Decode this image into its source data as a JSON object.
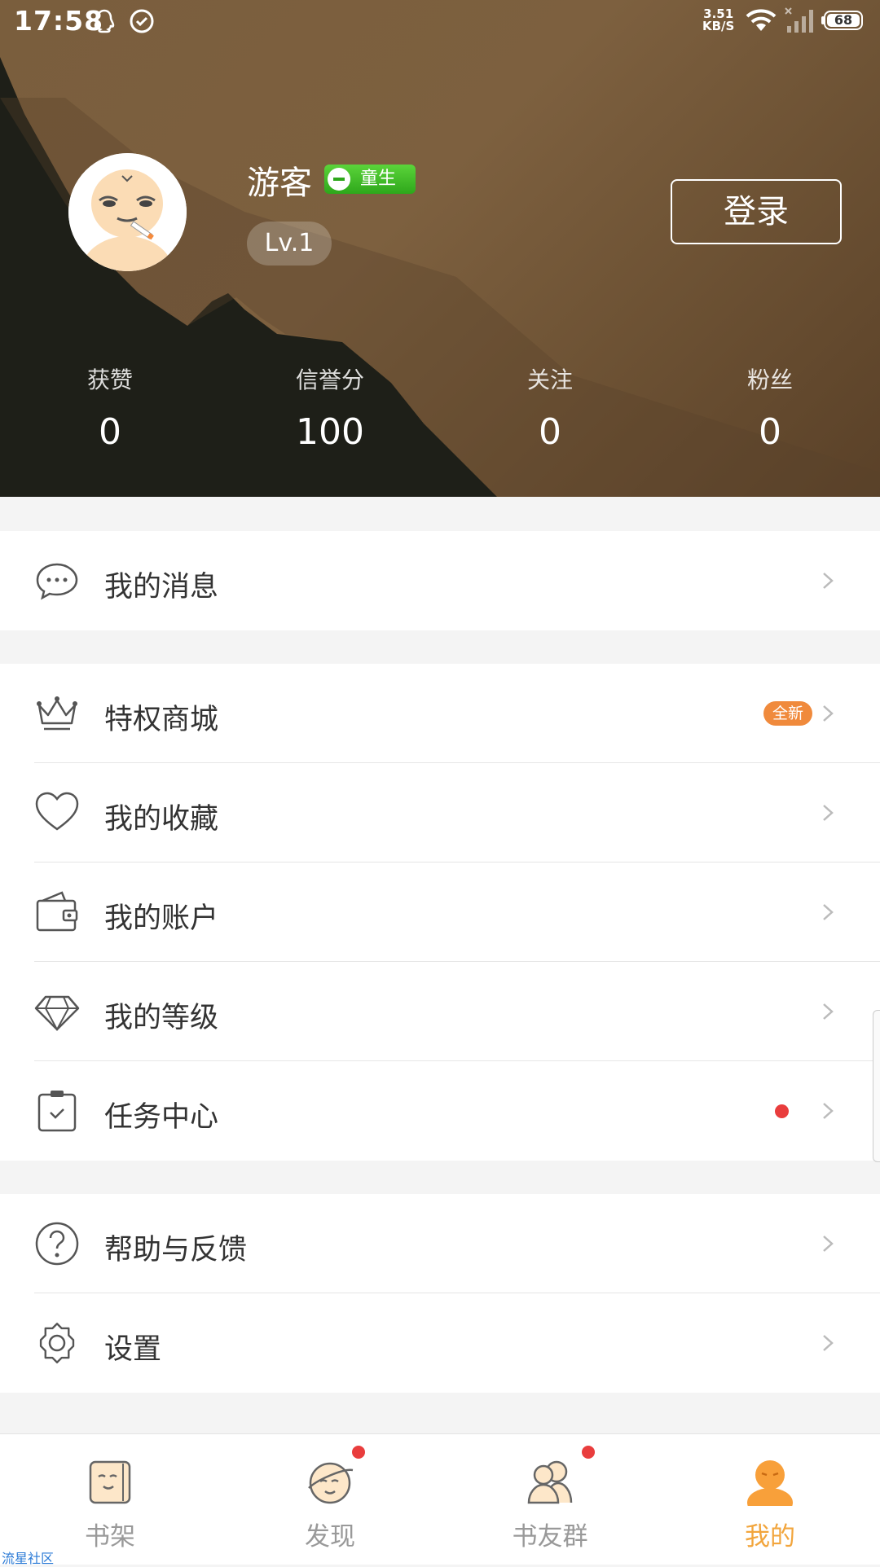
{
  "status_bar": {
    "time": "17:58",
    "net_speed_value": "3.51",
    "net_speed_unit": "KB/S",
    "battery": "68",
    "icons": [
      "qq-icon",
      "check-circle-icon",
      "wifi-icon",
      "signal-icon",
      "battery-icon"
    ]
  },
  "profile": {
    "username": "游客",
    "badge": "童生",
    "level": "Lv.1",
    "login_label": "登录"
  },
  "stats": [
    {
      "label": "获赞",
      "value": "0"
    },
    {
      "label": "信誉分",
      "value": "100"
    },
    {
      "label": "关注",
      "value": "0"
    },
    {
      "label": "粉丝",
      "value": "0"
    }
  ],
  "menu": {
    "messages": {
      "label": "我的消息",
      "icon": "chat-bubble-icon"
    },
    "privilege_store": {
      "label": "特权商城",
      "icon": "crown-icon",
      "badge": "全新"
    },
    "favorites": {
      "label": "我的收藏",
      "icon": "heart-icon"
    },
    "account": {
      "label": "我的账户",
      "icon": "wallet-icon"
    },
    "level": {
      "label": "我的等级",
      "icon": "diamond-icon"
    },
    "tasks": {
      "label": "任务中心",
      "icon": "clipboard-check-icon",
      "has_dot": true
    },
    "help": {
      "label": "帮助与反馈",
      "icon": "question-icon"
    },
    "settings": {
      "label": "设置",
      "icon": "gear-icon"
    }
  },
  "bottom_nav": {
    "tabs": [
      {
        "label": "书架",
        "icon": "bookshelf-icon"
      },
      {
        "label": "发现",
        "icon": "planet-icon",
        "has_dot": true
      },
      {
        "label": "书友群",
        "icon": "group-icon",
        "has_dot": true
      },
      {
        "label": "我的",
        "icon": "me-icon",
        "active": true
      }
    ],
    "active_color": "#f2a53c"
  },
  "watermark": "流星社区",
  "colors": {
    "header_bg": "#7a5e3d",
    "badge_orange": "#f08a3c",
    "dot_red": "#e93d3d",
    "badge_green": "#3cbf24"
  }
}
